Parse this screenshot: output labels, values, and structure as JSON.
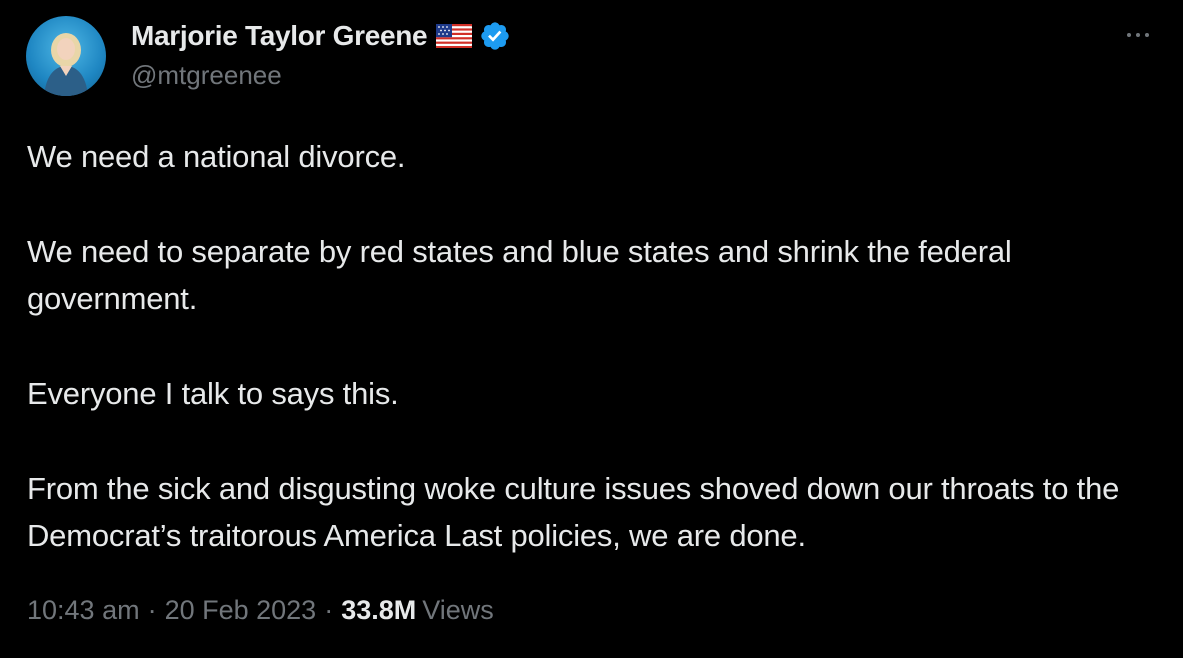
{
  "author": {
    "display_name": "Marjorie Taylor Greene",
    "handle": "@mtgreenee",
    "flag_icon": "us-flag-icon",
    "verified_icon": "verified-badge-icon",
    "verified_color": "#1d9bf0"
  },
  "tweet": {
    "paragraphs": [
      "We need a national divorce.",
      "We need to separate by red states and blue states and shrink the federal government.",
      "Everyone I talk to says this.",
      "From the sick and disgusting woke culture issues shoved down our throats to the Democrat’s traitorous America Last policies, we are done."
    ]
  },
  "meta": {
    "time": "10:43 am",
    "separator": "·",
    "date": "20 Feb 2023",
    "views_count": "33.8M",
    "views_label": "Views"
  },
  "colors": {
    "background": "#000000",
    "text": "#e7e9ea",
    "secondary": "#71767b"
  }
}
